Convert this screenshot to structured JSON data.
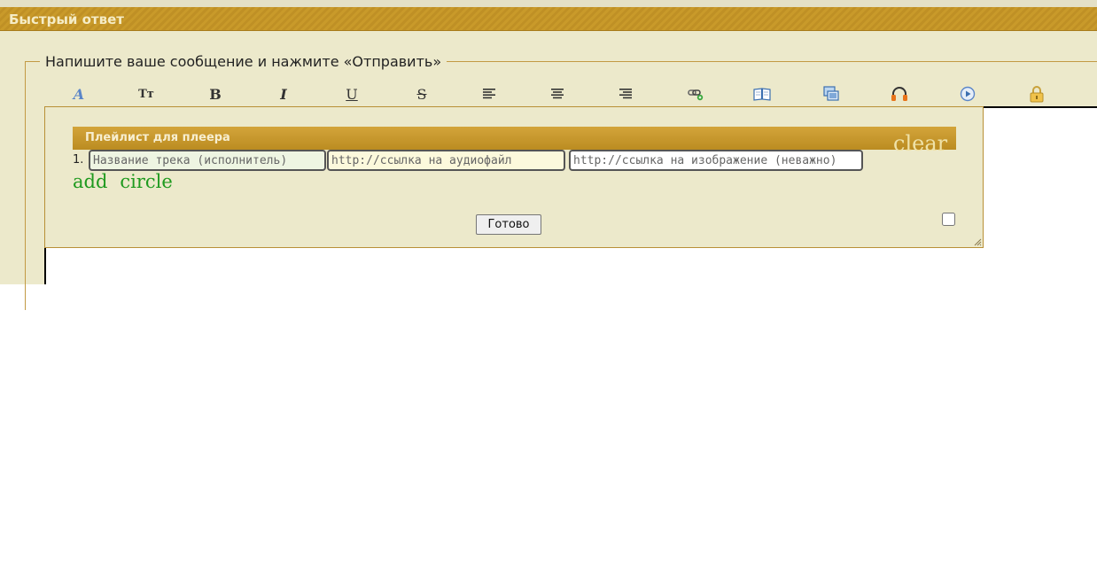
{
  "header": {
    "title": "Быстрый ответ"
  },
  "fieldset": {
    "legend": "Напишите ваше сообщение и нажмите «Отправить»"
  },
  "toolbar": {
    "font_glyph": "A",
    "size_glyph": "Tт",
    "bold_glyph": "B",
    "italic_glyph": "I",
    "underline_glyph": "U",
    "strike_glyph": "S"
  },
  "playlist": {
    "title": "Плейлист для плеера",
    "clear_label": "clear",
    "row_number": "1.",
    "track_placeholder": "Название трека (исполнитель)",
    "audio_placeholder": "http://ссылка на аудиофайл",
    "image_placeholder": "http://ссылка на изображение (неважно)",
    "add_label": "add",
    "circle_label": "circle",
    "done_label": "Готово"
  },
  "colors": {
    "header_gold": "#c99a2a",
    "panel_bg": "#ece9cb",
    "add_green": "#1f9a1f"
  }
}
